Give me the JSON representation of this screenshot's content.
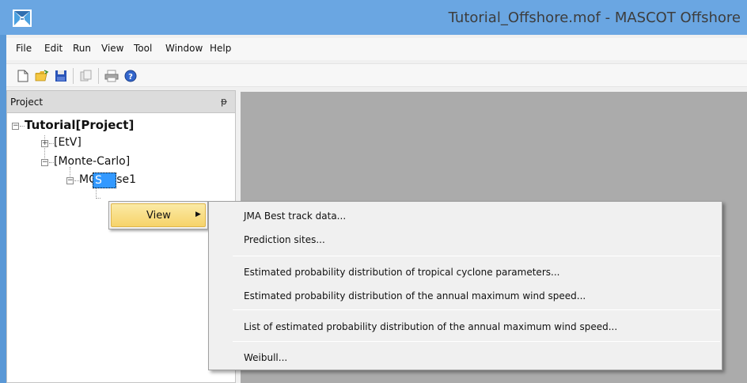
{
  "window": {
    "title": "Tutorial_Offshore.mof - MASCOT Offshore"
  },
  "menubar": {
    "items": [
      "File",
      "Edit",
      "Run",
      "View",
      "Tool",
      "Window",
      "Help"
    ]
  },
  "toolbar": {
    "buttons": [
      "new-file-icon",
      "open-folder-icon",
      "save-icon",
      "copy-icon",
      "print-icon",
      "help-icon"
    ]
  },
  "project_panel": {
    "title": "Project",
    "pin_glyph": "ᵽ",
    "tree": {
      "root": "Tutorial[Project]",
      "etv": "[EtV]",
      "monte_carlo": "[Monte-Carlo]",
      "mc_case": "MC_Case1",
      "selected_partial": "S"
    }
  },
  "context_menu": {
    "view_label": "View",
    "submenu": {
      "jma": "JMA Best track data...",
      "prediction_sites": "Prediction sites...",
      "tc_params": "Estimated probability distribution of tropical cyclone parameters...",
      "annual_max": "Estimated probability distribution of the annual maximum wind speed...",
      "list_annual_max": "List of estimated probability distribution of the annual maximum wind speed...",
      "weibull": "Weibull..."
    }
  },
  "colors": {
    "titlebar": "#6aa6e2",
    "selection": "#3399ff",
    "menu_highlight": "#f6d36a",
    "mdi_background": "#ababab"
  }
}
